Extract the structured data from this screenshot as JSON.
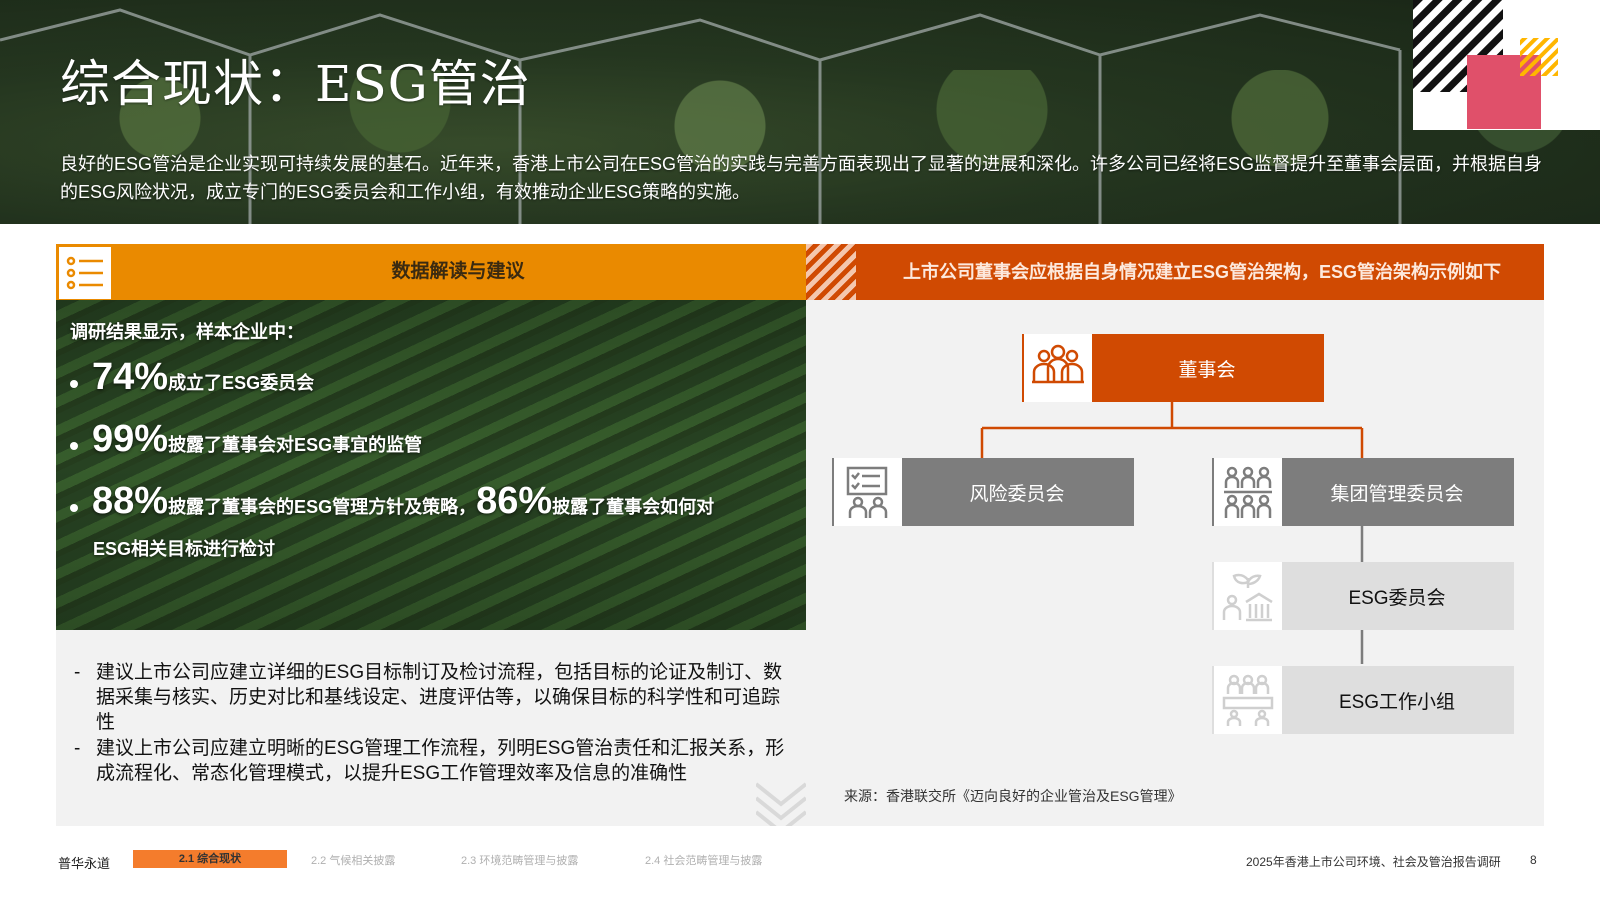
{
  "header": {
    "title": "综合现状：ESG管治",
    "intro": "良好的ESG管治是企业实现可持续发展的基石。近年来，香港上市公司在ESG管治的实践与完善方面表现出了显著的进展和深化。许多公司已经将ESG监督提升至董事会层面，并根据自身的ESG风险状况，成立专门的ESG委员会和工作小组，有效推动企业ESG策略的实施。"
  },
  "left_panel": {
    "header": "数据解读与建议",
    "survey_intro": "调研结果显示，样本企业中：",
    "stats": [
      {
        "value": "74%",
        "text": "成立了ESG委员会"
      },
      {
        "value": "99%",
        "text": "披露了董事会对ESG事宜的监管"
      },
      {
        "value": "88%",
        "text": "披露了董事会的ESG管理方针及策略，",
        "value2": "86%",
        "text2": "披露了董事会如何对",
        "text3": "ESG相关目标进行检讨"
      }
    ],
    "recommendations": [
      {
        "dash": "-",
        "text": "建议上市公司应建立详细的ESG目标制订及检讨流程，包括目标的论证及制订、数据采集与核实、历史对比和基线设定、进度评估等，以确保目标的科学性和可追踪性"
      },
      {
        "dash": "-",
        "text": "建议上市公司应建立明晰的ESG管理工作流程，列明ESG管治责任和汇报关系，形成流程化、常态化管理模式，以提升ESG工作管理效率及信息的准确性"
      }
    ]
  },
  "right_panel": {
    "header": "上市公司董事会应根据自身情况建立ESG管治架构，ESG管治架构示例如下",
    "org": {
      "board": "董事会",
      "risk_committee": "风险委员会",
      "group_committee": "集团管理委员会",
      "esg_committee": "ESG委员会",
      "esg_working_group": "ESG工作小组"
    },
    "icons": {
      "board": "people-group-icon",
      "risk": "checklist-people-icon",
      "group": "org-people-icon",
      "esg": "plant-building-icon",
      "working": "meeting-table-icon"
    },
    "source": "来源：香港联交所《迈向良好的企业管治及ESG管理》"
  },
  "footer": {
    "brand": "普华永道",
    "nav": [
      {
        "label": "2.1  综合现状",
        "active": true
      },
      {
        "label": "2.2  气候相关披露",
        "active": false
      },
      {
        "label": "2.3  环境范畴管理与披露",
        "active": false
      },
      {
        "label": "2.4  社会范畴管理与披露",
        "active": false
      }
    ],
    "report_title": "2025年香港上市公司环境、社会及管治报告调研",
    "page_number": "8"
  },
  "colors": {
    "orange": "#ea8a00",
    "dark_orange": "#d04a02",
    "grey": "#7d7d7d",
    "light_grey": "#dedede",
    "nav_active": "#f47c2c",
    "logo_pink": "#e0506a",
    "logo_yellow": "#ffb600"
  }
}
